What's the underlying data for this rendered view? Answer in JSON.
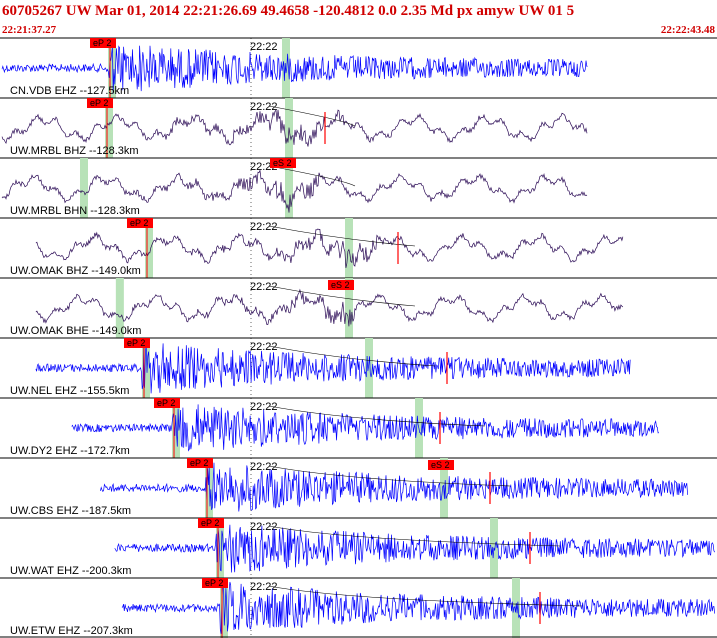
{
  "header": {
    "title": "60705267 UW Mar 01, 2014 22:21:26.69    49.4658 -120.4812  0.0 2.35 Md px amyw UW 01    5",
    "start_time": "22:21:37.27",
    "end_time": "22:22:43.48"
  },
  "colors": {
    "header_text": "#d00000",
    "trace_short_period": "#0000ff",
    "trace_broadband": "#2a0a55",
    "pick_box": "#ff0000",
    "pick_window": "#b8e2b8",
    "gridline": "#000000"
  },
  "chart_data": {
    "type": "seismogram",
    "time_window": [
      "22:21:37.27",
      "22:22:43.48"
    ],
    "minute_marker": "22:22",
    "traces": [
      {
        "label": "CN.VDB EHZ --127.5km",
        "channel_type": "short-period",
        "p_pick": "eP 2",
        "s_pick": "",
        "trace_start_frac": 0.0,
        "trace_end_frac": 0.82
      },
      {
        "label": "UW.MRBL BHZ --128.3km",
        "channel_type": "broadband",
        "p_pick": "eP 2",
        "s_pick": "",
        "trace_start_frac": 0.0,
        "trace_end_frac": 0.82
      },
      {
        "label": "UW.MRBL BHN --128.3km",
        "channel_type": "broadband",
        "p_pick": "",
        "s_pick": "eS 2",
        "trace_start_frac": 0.0,
        "trace_end_frac": 0.82
      },
      {
        "label": "UW.OMAK BHZ --149.0km",
        "channel_type": "broadband",
        "p_pick": "eP 2",
        "s_pick": "",
        "trace_start_frac": 0.05,
        "trace_end_frac": 0.87
      },
      {
        "label": "UW.OMAK BHE --149.0km",
        "channel_type": "broadband",
        "p_pick": "",
        "s_pick": "eS 2",
        "trace_start_frac": 0.05,
        "trace_end_frac": 0.87
      },
      {
        "label": "UW.NEL EHZ --155.5km",
        "channel_type": "short-period",
        "p_pick": "eP 2",
        "s_pick": "",
        "trace_start_frac": 0.05,
        "trace_end_frac": 0.88
      },
      {
        "label": "UW.DY2 EHZ --172.7km",
        "channel_type": "short-period",
        "p_pick": "eP 2",
        "s_pick": "",
        "trace_start_frac": 0.1,
        "trace_end_frac": 0.92
      },
      {
        "label": "UW.CBS EHZ --187.5km",
        "channel_type": "short-period",
        "p_pick": "eP 2",
        "s_pick": "eS 2",
        "trace_start_frac": 0.14,
        "trace_end_frac": 0.96
      },
      {
        "label": "UW.WAT EHZ --200.3km",
        "channel_type": "short-period",
        "p_pick": "eP 2",
        "s_pick": "",
        "trace_start_frac": 0.16,
        "trace_end_frac": 1.0
      },
      {
        "label": "UW.ETW EHZ --207.3km",
        "channel_type": "short-period",
        "p_pick": "eP 2",
        "s_pick": "",
        "trace_start_frac": 0.17,
        "trace_end_frac": 1.0
      }
    ]
  }
}
